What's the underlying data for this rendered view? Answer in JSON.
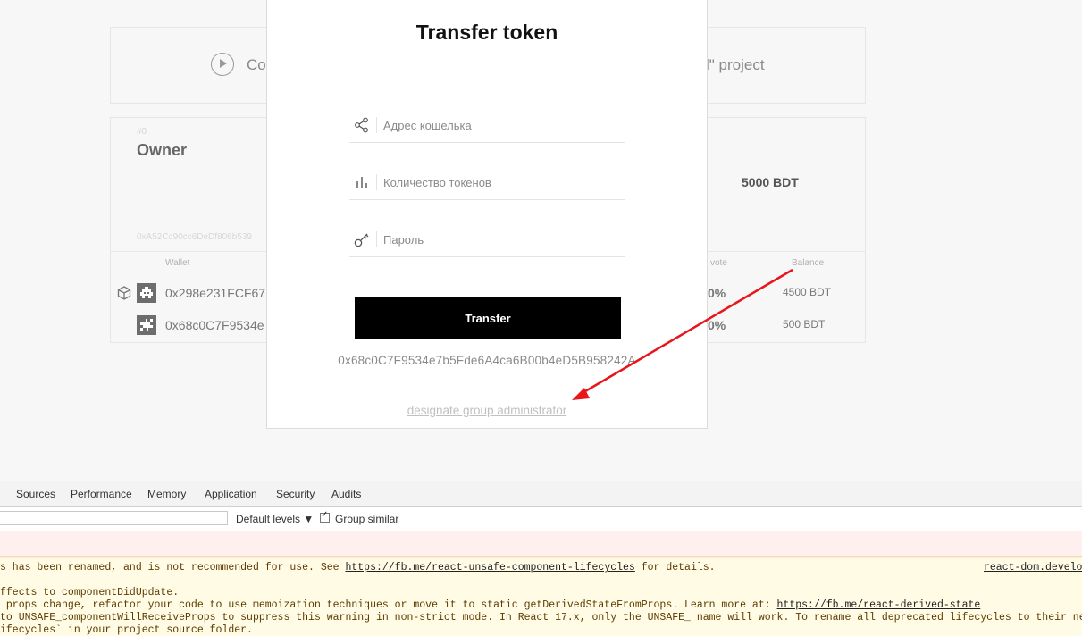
{
  "background": {
    "top_card": {
      "left_text": "Co",
      "right_text": "l\" project"
    },
    "main_card": {
      "index": "#0",
      "title": "Owner",
      "address": "0xA52Cc90cc6DeDf806b539",
      "total": "5000 BDT",
      "columns": {
        "wallet": "Wallet",
        "vote": "vote",
        "balance": "Balance"
      },
      "rows": [
        {
          "address": "0x298e231FCF67",
          "vote": "0%",
          "balance": "4500 BDT"
        },
        {
          "address": "0x68c0C7F9534e",
          "vote": "0%",
          "balance": "500 BDT"
        }
      ]
    }
  },
  "modal": {
    "title": "Transfer token",
    "fields": {
      "wallet": {
        "placeholder": "Адрес кошелька",
        "value": ""
      },
      "amount": {
        "placeholder": "Количество токенов",
        "value": ""
      },
      "password": {
        "placeholder": "Пароль",
        "value": ""
      }
    },
    "submit_label": "Transfer",
    "address": "0x68c0C7F9534e7b5Fde6A4ca6B00b4eD5B958242A",
    "link_label": "designate group administrator"
  },
  "annotation_color": "#e8151b",
  "devtools": {
    "tabs": [
      "Sources",
      "Performance",
      "Memory",
      "Application",
      "Security",
      "Audits"
    ],
    "levels_label": "Default levels ▼",
    "group_similar_label": "Group similar",
    "group_similar_checked": true,
    "warning_lines": [
      {
        "pre": "s has been renamed, and is not recommended for use. See ",
        "link": "https://fb.me/react-unsafe-component-lifecycles",
        "post": " for details."
      },
      {
        "pre": "ffects to componentDidUpdate.",
        "link": "",
        "post": ""
      },
      {
        "pre": " props change, refactor your code to use memoization techniques or move it to static getDerivedStateFromProps. Learn more at: ",
        "link": "https://fb.me/react-derived-state",
        "post": ""
      },
      {
        "pre": "to UNSAFE_componentWillReceiveProps to suppress this warning in non-strict mode. In React 17.x, only the UNSAFE_ name will work. To rename all deprecated lifecycles to their new names,",
        "link": "",
        "post": ""
      },
      {
        "pre": "ifecycles` in your project source folder.",
        "link": "",
        "post": ""
      }
    ],
    "source_link": "react-dom.develop"
  }
}
